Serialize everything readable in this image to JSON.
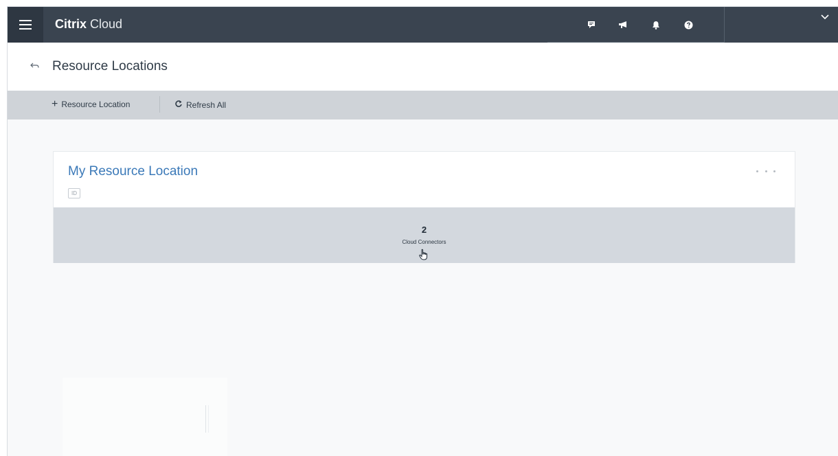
{
  "app": {
    "brand_bold": "Citrix",
    "brand_light": "Cloud"
  },
  "topbar": {
    "icons": [
      "feedback-icon",
      "announcement-icon",
      "bell-icon",
      "help-icon"
    ],
    "user_menu_icon": "chevron-down-icon"
  },
  "header": {
    "title": "Resource Locations",
    "back_icon": "back-arrow-icon"
  },
  "toolbar": {
    "add_label": "Resource Location",
    "refresh_label": "Refresh All"
  },
  "card": {
    "title": "My Resource Location",
    "id_badge": "ID",
    "connector_count": "2",
    "connector_label": "Cloud Connectors"
  },
  "colors": {
    "topbar": "#3a4450",
    "menu_button": "#2e3742",
    "toolbar": "#cfd3d8",
    "link_blue": "#3b79b8",
    "connector_panel": "#d3d8de"
  }
}
